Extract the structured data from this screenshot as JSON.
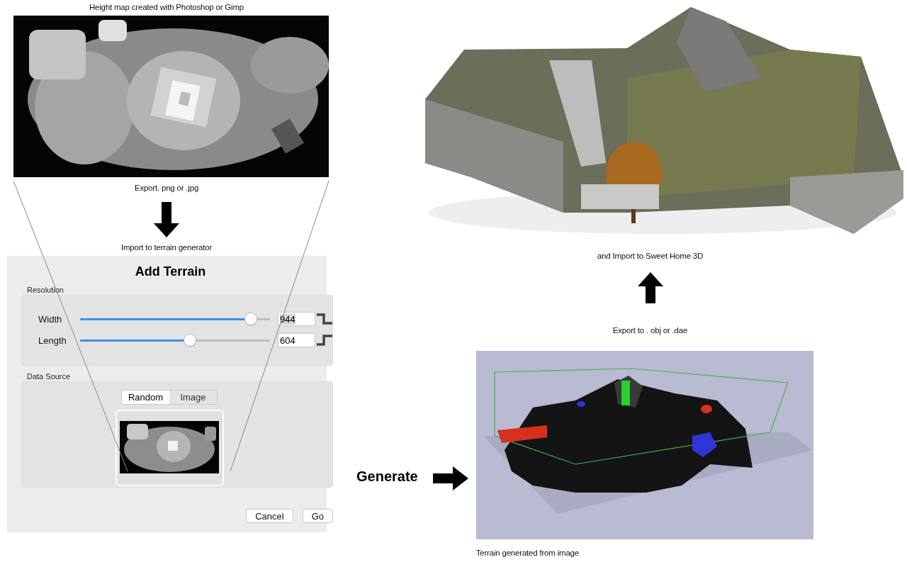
{
  "heightmap": {
    "caption": "Height map created with Photoshop or Gimp",
    "kind": "picture",
    "export_caption": "Export. png or .jpg",
    "import_caption": "Import to terrain generator"
  },
  "dialog": {
    "title": "Add Terrain",
    "resolution": {
      "label": "Resolution",
      "sliders": [
        {
          "label": "Width",
          "level": 0.9,
          "value": "944"
        },
        {
          "label": "Length",
          "level": 0.58,
          "value": "604"
        }
      ]
    },
    "data_source": {
      "label": "Data Source",
      "options": [
        {
          "label": "Random",
          "selected": true
        },
        {
          "label": "Image",
          "selected": false
        }
      ]
    },
    "buttons": [
      {
        "label": "Cancel"
      },
      {
        "label": "Go"
      }
    ]
  },
  "render": {
    "kind": "picture",
    "caption": "and Import to Sweet Home 3D",
    "export_caption": "Export to . obj  or .dae"
  },
  "generate_label": "Generate",
  "viewport": {
    "kind": "picture",
    "caption": "Terrain generated from image"
  }
}
